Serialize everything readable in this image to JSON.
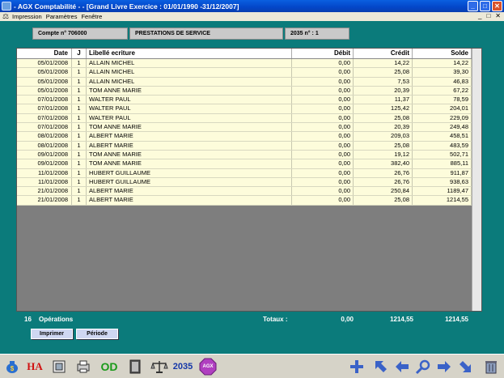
{
  "window": {
    "title": "- AGX Comptabilité - - [Grand Livre Exercice : 01/01/1990 -31/12/2007]",
    "minimize": "_",
    "maximize": "□",
    "close": "✕"
  },
  "menu": {
    "items": [
      "Impression",
      "Paramètres",
      "Fenêtre"
    ],
    "mdi": [
      "_",
      "□",
      "✕"
    ]
  },
  "header": {
    "compte": "Compte n° 706000",
    "libelle": "PRESTATIONS DE SERVICE",
    "n2035": "2035 n° : 1"
  },
  "table": {
    "columns": [
      "Date",
      "J",
      "Libellé ecriture",
      "Débit",
      "Crédit",
      "Solde"
    ],
    "rows": [
      [
        "05/01/2008",
        "1",
        "ALLAIN MICHEL",
        "0,00",
        "14,22",
        "14,22"
      ],
      [
        "05/01/2008",
        "1",
        "ALLAIN MICHEL",
        "0,00",
        "25,08",
        "39,30"
      ],
      [
        "05/01/2008",
        "1",
        "ALLAIN MICHEL",
        "0,00",
        "7,53",
        "46,83"
      ],
      [
        "05/01/2008",
        "1",
        "TOM ANNE MARIE",
        "0,00",
        "20,39",
        "67,22"
      ],
      [
        "07/01/2008",
        "1",
        "WALTER PAUL",
        "0,00",
        "11,37",
        "78,59"
      ],
      [
        "07/01/2008",
        "1",
        "WALTER PAUL",
        "0,00",
        "125,42",
        "204,01"
      ],
      [
        "07/01/2008",
        "1",
        "WALTER PAUL",
        "0,00",
        "25,08",
        "229,09"
      ],
      [
        "07/01/2008",
        "1",
        "TOM ANNE MARIE",
        "0,00",
        "20,39",
        "249,48"
      ],
      [
        "08/01/2008",
        "1",
        "ALBERT MARIE",
        "0,00",
        "209,03",
        "458,51"
      ],
      [
        "08/01/2008",
        "1",
        "ALBERT MARIE",
        "0,00",
        "25,08",
        "483,59"
      ],
      [
        "09/01/2008",
        "1",
        "TOM ANNE MARIE",
        "0,00",
        "19,12",
        "502,71"
      ],
      [
        "09/01/2008",
        "1",
        "TOM ANNE MARIE",
        "0,00",
        "382,40",
        "885,11"
      ],
      [
        "11/01/2008",
        "1",
        "HUBERT GUILLAUME",
        "0,00",
        "26,76",
        "911,87"
      ],
      [
        "11/01/2008",
        "1",
        "HUBERT GUILLAUME",
        "0,00",
        "26,76",
        "938,63"
      ],
      [
        "21/01/2008",
        "1",
        "ALBERT MARIE",
        "0,00",
        "250,84",
        "1189,47"
      ],
      [
        "21/01/2008",
        "1",
        "ALBERT MARIE",
        "0,00",
        "25,08",
        "1214,55"
      ]
    ]
  },
  "totals": {
    "count": "16",
    "operations_label": "Opérations",
    "totaux_label": "Totaux :",
    "debit": "0,00",
    "credit": "1214,55",
    "solde": "1214,55"
  },
  "buttons": {
    "imprimer": "Imprimer",
    "periode": "Période"
  },
  "toolbar": {
    "ha": "HA",
    "od": "OD",
    "n2035": "2035",
    "agx": "AGX"
  },
  "colors": {
    "background": "#0b7b7b",
    "row": "#fdfcdb",
    "accent_green": "#1a9a1a",
    "accent_red": "#d01010",
    "agx_purple": "#b03fc0"
  }
}
